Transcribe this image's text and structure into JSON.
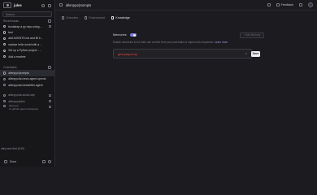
{
  "app": {
    "title": "jules"
  },
  "sidebar": {
    "search_placeholder": "Search",
    "recent_label": "Recent tasks",
    "recent": [
      {
        "label": "bootstrap a py repo using ..."
      },
      {
        "label": "test"
      },
      {
        "label": "add AGENTS.md and fill it ..."
      },
      {
        "label": "replace hello world with a ..."
      },
      {
        "label": "Set up a Python project - ..."
      },
      {
        "label": "Add a readme"
      }
    ],
    "codebases_label": "Codebases",
    "codebases": [
      {
        "label": "allenpyo/prompts"
      },
      {
        "label": "allenpyo/ai-news-agent-openai"
      },
      {
        "label": "allenpyo/ai-newsletter-agent"
      },
      {
        "label": "allenpyo/ai-studio-wip"
      },
      {
        "label": "allenpyo/jules"
      }
    ],
    "multi": {
      "line1": "allenpyo/",
      "line2": "cv-github-agent-workspace"
    },
    "daily_limit": "daily task limit (0/15)",
    "footer": {
      "docs": "Docs"
    }
  },
  "topbar": {
    "repo": "allenpyo/prompts",
    "feedback": "Feedback"
  },
  "tabs": [
    {
      "label": "Overview",
      "active": false
    },
    {
      "label": "Environment",
      "active": false
    },
    {
      "label": "Knowledge",
      "active": true
    }
  ],
  "memories": {
    "label": "Memories",
    "enabled": true,
    "add_button": "+ Add Memory",
    "description": "Enable memories to let Jules use context from your past tasks to improve its responses.",
    "learn_more": "Learn more",
    "input_value": "glnnpaqoxmy",
    "save_label": "Save"
  },
  "colors": {
    "accent": "#7d7de0",
    "error_text": "#e0473e"
  }
}
